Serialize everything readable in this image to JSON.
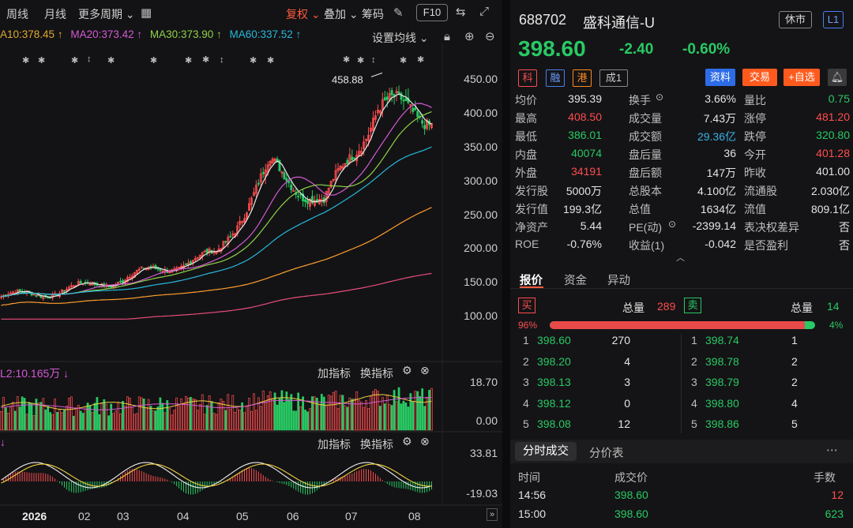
{
  "toolbar": {
    "week": "周线",
    "month": "月线",
    "more_periods": "更多周期",
    "fuquan": "复权",
    "overlay": "叠加",
    "chips": "筹码",
    "f10": "F10",
    "set_ma": "设置均线"
  },
  "ma": {
    "ma10": "A10:378.45 ↑",
    "ma20": "MA20:373.42 ↑",
    "ma30": "MA30:373.90 ↑",
    "ma60": "MA60:337.52 ↑"
  },
  "colors": {
    "up": "#ff4d4f",
    "down": "#29c964",
    "ma10": "#e8e8e8",
    "ma20": "#d45ad4",
    "ma30": "#8fd14a",
    "ma60": "#27b8d9",
    "ma120": "#ff9f2e",
    "ma250": "#e84d7a",
    "accent": "#ff5a3c"
  },
  "price_axis": [
    "450.00",
    "400.00",
    "350.00",
    "300.00",
    "250.00",
    "200.00",
    "150.00",
    "100.00"
  ],
  "peak_label": "458.88",
  "volume_panel": {
    "label": "L2:10.165万 ↓",
    "add": "加指标",
    "swap": "换指标",
    "top": "18.70",
    "bottom": "0.00"
  },
  "macd_panel": {
    "label": "↓",
    "add": "加指标",
    "swap": "换指标",
    "top": "33.81",
    "bottom": "-19.03"
  },
  "x_axis": [
    "2026",
    "02",
    "03",
    "04",
    "05",
    "06",
    "07",
    "08"
  ],
  "chart_data": {
    "type": "candlestick",
    "x": [
      "2025-12",
      "2026-01",
      "2026-02",
      "2026-03",
      "2026-04",
      "2026-05",
      "2026-06",
      "2026-07",
      "2026-08"
    ],
    "close_approx": [
      128,
      135,
      150,
      170,
      190,
      320,
      265,
      410,
      398.6
    ],
    "high_marker": 458.88,
    "ylim": [
      100,
      470
    ]
  },
  "quote": {
    "code": "688702",
    "name": "盛科通信-U",
    "status": "休市",
    "level": "L1",
    "price": "398.60",
    "change": "-2.40",
    "pct": "-0.60%",
    "tags": [
      "科",
      "融",
      "港",
      "成1"
    ],
    "btn_info": "资料",
    "btn_trade": "交易",
    "btn_watch": "+自选"
  },
  "stats": [
    [
      [
        "均价",
        "395.39",
        "white"
      ],
      [
        "换手",
        "3.66%",
        "white"
      ],
      [
        "量比",
        "0.75",
        "green"
      ]
    ],
    [
      [
        "最高",
        "408.50",
        "red"
      ],
      [
        "成交量",
        "7.43万",
        "white"
      ],
      [
        "涨停",
        "481.20",
        "red"
      ]
    ],
    [
      [
        "最低",
        "386.01",
        "green"
      ],
      [
        "成交额",
        "29.36亿",
        "cyan"
      ],
      [
        "跌停",
        "320.80",
        "green"
      ]
    ],
    [
      [
        "内盘",
        "40074",
        "green"
      ],
      [
        "盘后量",
        "36",
        "white"
      ],
      [
        "今开",
        "401.28",
        "red"
      ]
    ],
    [
      [
        "外盘",
        "34191",
        "red"
      ],
      [
        "盘后额",
        "147万",
        "white"
      ],
      [
        "昨收",
        "401.00",
        "white"
      ]
    ],
    [
      [
        "发行股",
        "5000万",
        "white"
      ],
      [
        "总股本",
        "4.100亿",
        "white"
      ],
      [
        "流通股",
        "2.030亿",
        "white"
      ]
    ],
    [
      [
        "发行值",
        "199.3亿",
        "white"
      ],
      [
        "总值",
        "1634亿",
        "white"
      ],
      [
        "流值",
        "809.1亿",
        "white"
      ]
    ],
    [
      [
        "净资产",
        "5.44",
        "white"
      ],
      [
        "PE(动)",
        "-2399.14",
        "white"
      ],
      [
        "表决权差异",
        "否",
        "white"
      ]
    ],
    [
      [
        "ROE",
        "-0.76%",
        "white"
      ],
      [
        "收益(1)",
        "-0.042",
        "white"
      ],
      [
        "是否盈利",
        "否",
        "white"
      ]
    ]
  ],
  "orderbook": {
    "tabs": [
      "报价",
      "资金",
      "异动"
    ],
    "buy_label": "买",
    "sell_label": "卖",
    "buy_total_label": "总量",
    "buy_total": "289",
    "sell_total_label": "总量",
    "sell_total": "14",
    "buy_pct": "96%",
    "sell_pct": "4%",
    "buy_ratio": 0.96,
    "bids": [
      [
        "1",
        "398.60",
        "270"
      ],
      [
        "2",
        "398.20",
        "4"
      ],
      [
        "3",
        "398.13",
        "3"
      ],
      [
        "4",
        "398.12",
        "0"
      ],
      [
        "5",
        "398.08",
        "12"
      ]
    ],
    "asks": [
      [
        "1",
        "398.74",
        "1"
      ],
      [
        "2",
        "398.78",
        "2"
      ],
      [
        "3",
        "398.79",
        "2"
      ],
      [
        "4",
        "398.80",
        "4"
      ],
      [
        "5",
        "398.86",
        "5"
      ]
    ]
  },
  "trades": {
    "tabs": [
      "分时成交",
      "分价表"
    ],
    "headers": [
      "时间",
      "成交价",
      "手数"
    ],
    "rows": [
      [
        "14:56",
        "398.60",
        "12"
      ],
      [
        "15:00",
        "398.60",
        "623"
      ]
    ]
  }
}
